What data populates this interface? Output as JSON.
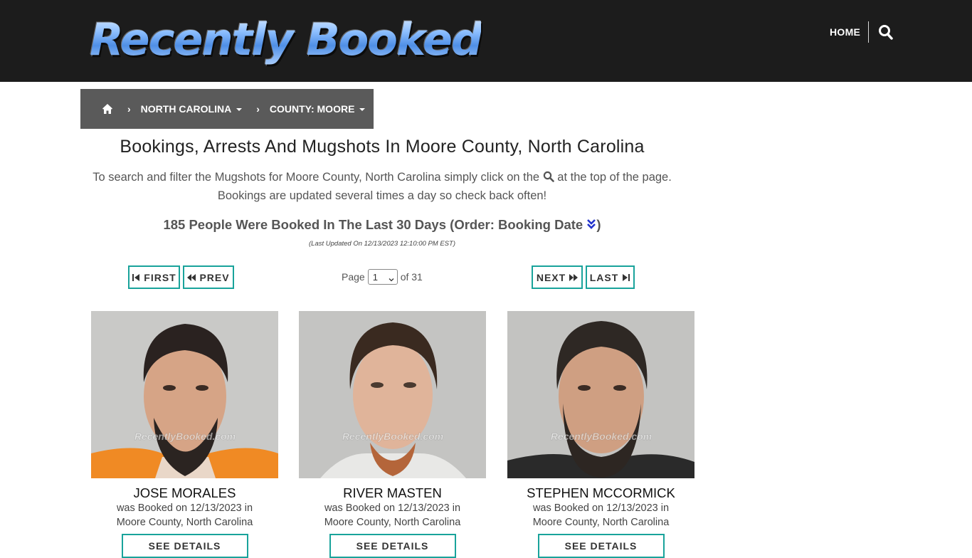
{
  "header": {
    "logo_text": "Recently Booked",
    "nav_home": "HOME",
    "search_icon": "search-icon"
  },
  "breadcrumb": {
    "home_icon": "home-icon",
    "state": "NORTH CAROLINA",
    "county": "COUNTY: MOORE"
  },
  "main": {
    "title": "Bookings, Arrests And Mugshots In Moore County, North Carolina",
    "intro_line1_pre": "To search and filter the Mugshots for Moore County, North Carolina simply click on the",
    "intro_line1_post": "at the top of the page.",
    "intro_line2": "Bookings are updated several times a day so check back often!",
    "count_text": "185 People Were Booked In The Last 30 Days (Order: Booking Date",
    "count_close": ")",
    "last_updated": "(Last Updated On 12/13/2023 12:10:00 PM EST)"
  },
  "pagination": {
    "first": "FIRST",
    "prev": "PREV",
    "next": "NEXT",
    "last": "LAST",
    "page_label": "Page",
    "current_page": "1",
    "of_label": "of 31"
  },
  "bookings": [
    {
      "name": "JOSE MORALES",
      "line1": "was Booked on 12/13/2023 in",
      "line2": "Moore County, North Carolina",
      "button": "SEE DETAILS",
      "watermark": "RecentlyBooked.com"
    },
    {
      "name": "RIVER MASTEN",
      "line1": "was Booked on 12/13/2023 in",
      "line2": "Moore County, North Carolina",
      "button": "SEE DETAILS",
      "watermark": "RecentlyBooked.com"
    },
    {
      "name": "STEPHEN MCCORMICK",
      "line1": "was Booked on 12/13/2023 in",
      "line2": "Moore County, North Carolina",
      "button": "SEE DETAILS",
      "watermark": "RecentlyBooked.com"
    }
  ],
  "colors": {
    "accent": "#19a39b",
    "header_bg": "#1c1c1c",
    "breadcrumb_bg": "#5a5a5a",
    "order_icon": "#2233cc"
  }
}
